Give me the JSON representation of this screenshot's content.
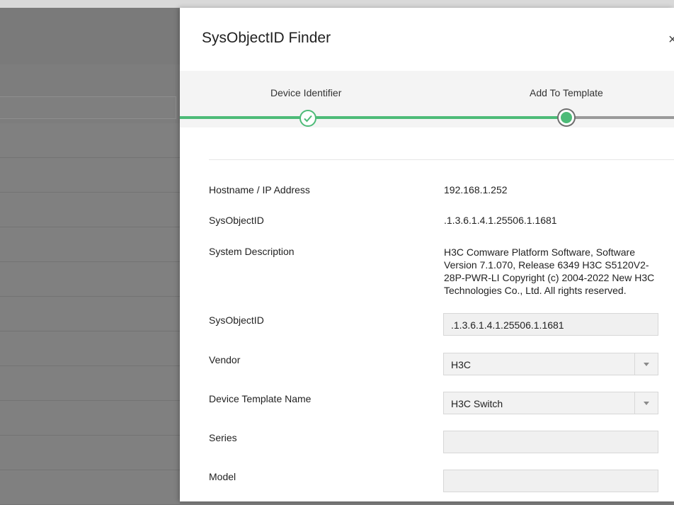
{
  "modal": {
    "title": "SysObjectID Finder",
    "close_glyph": "×"
  },
  "stepper": {
    "steps": [
      {
        "label": "Device Identifier",
        "state": "completed"
      },
      {
        "label": "Add To Template",
        "state": "current"
      }
    ],
    "colors": {
      "completed": "#4dbb78",
      "pending": "#9a9a9a"
    }
  },
  "details": {
    "hostname_label": "Hostname / IP Address",
    "hostname_value": "192.168.1.252",
    "sysobjectid_label": "SysObjectID",
    "sysobjectid_value": ".1.3.6.1.4.1.25506.1.1681",
    "sysdesc_label": "System Description",
    "sysdesc_value": "H3C Comware Platform Software, Software Version 7.1.070, Release 6349 H3C S5120V2-28P-PWR-LI Copyright (c) 2004-2022 New H3C Technologies Co., Ltd. All rights reserved."
  },
  "form": {
    "sysobjectid_label": "SysObjectID",
    "sysobjectid_value": ".1.3.6.1.4.1.25506.1.1681",
    "vendor_label": "Vendor",
    "vendor_value": "H3C",
    "template_label": "Device Template Name",
    "template_value": "H3C Switch",
    "series_label": "Series",
    "series_value": "",
    "model_label": "Model",
    "model_value": ""
  }
}
